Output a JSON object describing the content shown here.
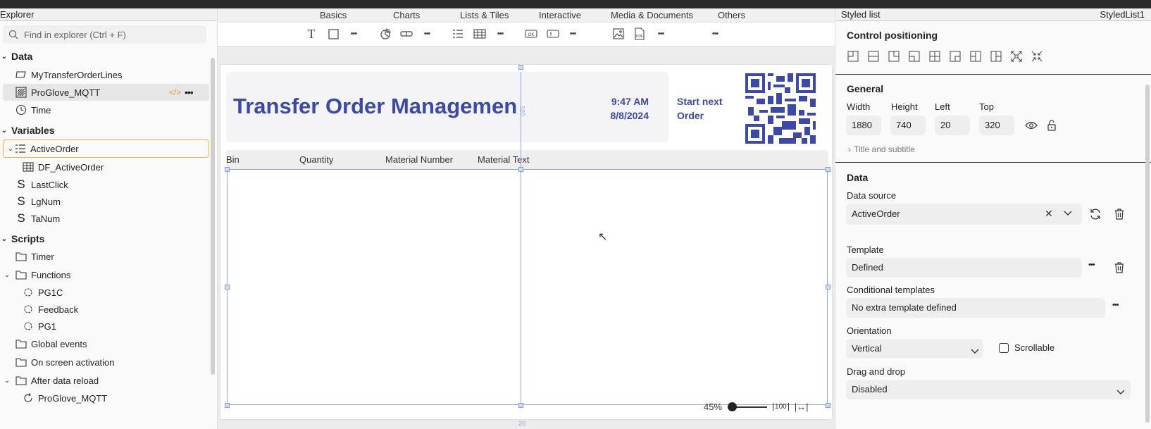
{
  "explorer": {
    "title": "Explorer",
    "search_placeholder": "Find in explorer (Ctrl + F)",
    "groups": [
      {
        "label": "Data",
        "items": [
          {
            "label": "MyTransferOrderLines",
            "icon": "table-link-icon"
          },
          {
            "label": "ProGlove_MQTT",
            "icon": "stream-icon",
            "selected": true
          },
          {
            "label": "Time",
            "icon": "clock-icon"
          }
        ]
      },
      {
        "label": "Variables",
        "items": [
          {
            "label": "ActiveOrder",
            "icon": "list-variable-icon",
            "active": true
          },
          {
            "label": "DF_ActiveOrder",
            "icon": "datatable-icon"
          },
          {
            "label": "LastClick",
            "icon": "string-variable-icon"
          },
          {
            "label": "LgNum",
            "icon": "string-variable-icon"
          },
          {
            "label": "TaNum",
            "icon": "string-variable-icon"
          }
        ]
      },
      {
        "label": "Scripts",
        "items": [
          {
            "label": "Timer",
            "icon": "folder-icon"
          },
          {
            "label": "Functions",
            "icon": "folder-icon"
          },
          {
            "label": "PG1C",
            "icon": "function-icon"
          },
          {
            "label": "Feedback",
            "icon": "function-icon"
          },
          {
            "label": "PG1",
            "icon": "function-icon"
          },
          {
            "label": "Global events",
            "icon": "folder-icon"
          },
          {
            "label": "On screen activation",
            "icon": "folder-icon"
          },
          {
            "label": "After data reload",
            "icon": "folder-icon"
          },
          {
            "label": "ProGlove_MQTT",
            "icon": "reload-icon"
          }
        ]
      }
    ]
  },
  "ribbon": {
    "tabs": [
      "Basics",
      "Charts",
      "Lists & Tiles",
      "Interactive",
      "Media & Documents",
      "Others"
    ]
  },
  "canvas": {
    "title": "Transfer Order Managemen",
    "time": "9:47 AM",
    "date": "8/8/2024",
    "start_next_line1": "Start next",
    "start_next_line2": "Order",
    "columns": [
      "Bin",
      "Quantity",
      "Material Number",
      "Material Text"
    ],
    "guide_top": "320",
    "guide_bottom": "20",
    "zoom": "45%",
    "zoom_100": "100"
  },
  "props": {
    "title": "Styled list",
    "control_name": "StyledList1",
    "positioning_label": "Control positioning",
    "general_label": "General",
    "width_label": "Width",
    "height_label": "Height",
    "left_label": "Left",
    "top_label": "Top",
    "width": "1880",
    "height": "740",
    "left": "20",
    "top": "320",
    "title_subtitle": "Title and subtitle",
    "data_label": "Data",
    "data_source_label": "Data source",
    "data_source": "ActiveOrder",
    "template_label": "Template",
    "template": "Defined",
    "cond_templates_label": "Conditional templates",
    "cond_templates": "No extra template defined",
    "orientation_label": "Orientation",
    "orientation": "Vertical",
    "scrollable_label": "Scrollable",
    "drag_drop_label": "Drag and drop",
    "drag_drop": "Disabled"
  },
  "colors": {
    "accent": "#3b4aa8",
    "active_border": "#f0b42a",
    "selection": "#8aa9de"
  }
}
